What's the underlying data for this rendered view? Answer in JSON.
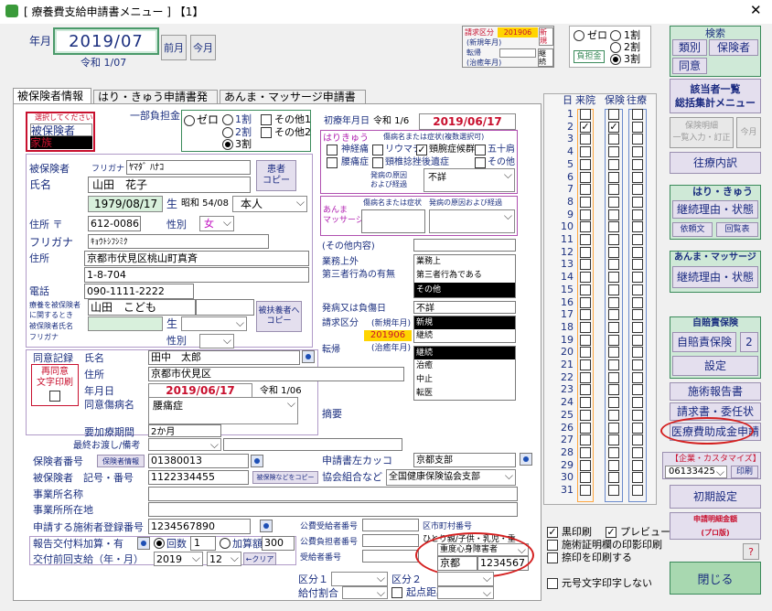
{
  "window": {
    "title": "[ 療養費支給申請書メニュー ] 【1】",
    "close": "✕"
  },
  "header": {
    "nengetsu_label": "年月",
    "nengetsu": "2019/07",
    "reiwa": "令和 1/07",
    "prev": "前月",
    "this": "今月"
  },
  "seikyu": {
    "kubun_label": "請求区分",
    "kubun_value": "201906",
    "new": "新規",
    "new_nengetsu": "(新規年月)",
    "tenki": "転帰",
    "keizoku": "継続",
    "chiyu": "(治癒年月)"
  },
  "futan_top": {
    "zero": "ゼロ",
    "one": "1割",
    "two": "2割",
    "three": "3割",
    "futan_btn": "負担金"
  },
  "kensaku": {
    "title": "検索",
    "ruibetsu": "類別",
    "hokensha": "保険者",
    "doui": "同意"
  },
  "right": {
    "gaito": "該当者一覧\n総括集計メニュー",
    "meisai": "保険明細\n一覧入力・訂正",
    "kongetsu": "今月",
    "ourai": "往療内訳",
    "hari_title": "はり・きゅう",
    "keizoku_jotai": "継続理由・状態",
    "iraibun": "依頼文",
    "kaitoubun": "回覧表",
    "anma_title": "あんま・マッサージ",
    "keizoku_jotai2": "継続理由・状態",
    "jibai_title": "自賠責保険",
    "jibai": "自賠責保険",
    "two": "2",
    "settei": "設定",
    "shijutsu": "施術報告書",
    "seikyusho": "請求書・委任状",
    "iryohi": "医療費助成金申請",
    "kigyo": "【企業・カスタマイズ】",
    "kigyo_val": "06133425",
    "insatsu": "印刷",
    "shoki": "初期設定",
    "ikusei": "申請明細金額\n(プロ版)",
    "help": "?",
    "close": "閉じる"
  },
  "days": {
    "h_day": "日",
    "h_visit": "来院",
    "h_hoken": "保険",
    "h_ourai": "往療",
    "list": [
      "1",
      "2",
      "3",
      "4",
      "5",
      "6",
      "7",
      "8",
      "9",
      "10",
      "11",
      "12",
      "13",
      "14",
      "15",
      "16",
      "17",
      "18",
      "19",
      "20",
      "21",
      "22",
      "23",
      "24",
      "25",
      "26",
      "27",
      "28",
      "29",
      "30",
      "31"
    ]
  },
  "print_opts": {
    "kuro": "黒印刷",
    "preview": "プレビュー",
    "shomei": "施術証明欄の印影印刷",
    "atoin": "捺印を印刷する",
    "genko": "元号文字印字しない"
  },
  "tabs": [
    "被保険者情報",
    "はり・きゅう申請書発行",
    "あんま・マッサージ申請書発行"
  ],
  "select_box": {
    "title": "選択してください",
    "opt1": "被保険者",
    "opt2": "家族"
  },
  "ichibu": {
    "label": "一部負担金",
    "zero": "ゼロ",
    "one": "1割",
    "two": "2割",
    "three": "3割",
    "other1": "その他1",
    "other2": "その他2"
  },
  "patient": {
    "hihokensha_label": "被保険者",
    "furigana_lbl": "フリガナ",
    "furigana": "ﾔﾏﾀﾞ ﾊﾅｺ",
    "name_label": "氏名",
    "name": "山田　花子",
    "copy_btn": "患者\nコピー",
    "birth": "1979/08/17",
    "sei": "生",
    "showa": "昭和 54/08",
    "honnin": "本人",
    "address_label": "住所 〒",
    "zip": "612-0086",
    "seibetsu": "性別",
    "sex": "女",
    "furigana2_label": "フリガナ",
    "kana_addr": "ｷｮｳﾄｼﾌｼﾐｸ",
    "addr_label": "住所",
    "addr1": "京都市伏見区桃山町真斉",
    "addr2": "1-8-704",
    "tel_label": "電話",
    "tel": "090-1111-2222",
    "dep_label1": "療養を被保険者",
    "dep_label2": "に関するとき",
    "dep_label3": "被保険者氏名",
    "dep_label4": "フリガナ",
    "dep_name": "山田　こども",
    "dep_copy": "被扶養者へ\nコピー",
    "dep_sei": "生",
    "dep_seibetsu": "性別"
  },
  "shoken": {
    "shoken_label": "初療年月日",
    "reiwa": "令和 1/6",
    "date": "2019/06/17",
    "hari_label": "はりきゅう",
    "syobyo_hdr": "傷病名または症状(複数選択可)",
    "c1": "神経痛",
    "c2": "リウマチ",
    "c3": "頸腕症候群",
    "c4": "五十肩",
    "c5": "腰痛症",
    "c6": "頸椎捻挫後遺症",
    "c7": "その他",
    "hassei": "発病の原因\nおよび経過",
    "fumei": "不詳",
    "anma_label": "あんま\nマッサージ",
    "anma_hdr": "傷病名または症状　発病の原因および経過",
    "sonota": "(その他内容)",
    "gyomu": "業務上外\n第三者行為の有無",
    "g1": "業務上",
    "g2": "第三者行為である",
    "g3": "その他",
    "hasshobi": "発病又は負傷日",
    "hasshobi_val": "不詳",
    "seikyu_kubun": "請求区分",
    "new_nengetsu": "(新規年月)",
    "s1": "新規",
    "s2": "継続",
    "tenki": "転帰",
    "chiyu_nengetsu": "(治癒年月)",
    "k201906": "201906",
    "t1": "継続",
    "t2": "治癒",
    "t3": "中止",
    "t4": "転医"
  },
  "doui": {
    "label": "同意記録",
    "name_label": "氏名",
    "name": "田中　太郎",
    "addr_label": "住所",
    "addr": "京都市伏見区",
    "date_label": "年月日",
    "date": "2019/06/17",
    "reiwa": "令和 1/06",
    "byomei_label": "同意傷病名",
    "byomei": "腰痛症",
    "kikan_label": "要加療期間",
    "kikan": "2か月",
    "saishu": "最終お渡し/備考",
    "reprint": "再同意\n文字印刷",
    "tekiyo": "摘要"
  },
  "hoken": {
    "no_label": "保険者番号",
    "info_btn": "保険者情報",
    "no": "01380013",
    "kigo_label": "被保険者　記号・番号",
    "kigo": "1122334455",
    "copy_btn": "被保険などをコピー",
    "kumiai_label": "協会組合など",
    "kumiai": "全国健康保険協会支部",
    "kakko_label": "申請書左カッコ",
    "kakko": "京都支部",
    "jigyo_name": "事業所名称",
    "jigyo_addr": "事業所所在地",
    "tourokubango_label": "申請する施術者登録番号",
    "tourokubango": "1234567890"
  },
  "bottom": {
    "kofu_label": "報告交付料加算・有",
    "kaisu": "回数",
    "kaisu_val": "1",
    "kasangaku": "加算額",
    "kasangaku_val": "300",
    "zenkai": "交付前回支給（年・月）",
    "year": "2019",
    "month": "12",
    "clear": "←クリア",
    "kohi1": "公費受給者番号",
    "kohi2": "公費負担者番号",
    "jukyusha": "受給者番号",
    "shichoson": "区市町村番号",
    "hitori": "ひとり親/子供・乳児・重",
    "jushin": "重度心身障害者",
    "kyoto": "京都",
    "kyoto_no": "1234567",
    "kubun1": "区分１",
    "kubun2": "区分２",
    "kyufu": "給付割合",
    "kiten": "起点距離"
  }
}
